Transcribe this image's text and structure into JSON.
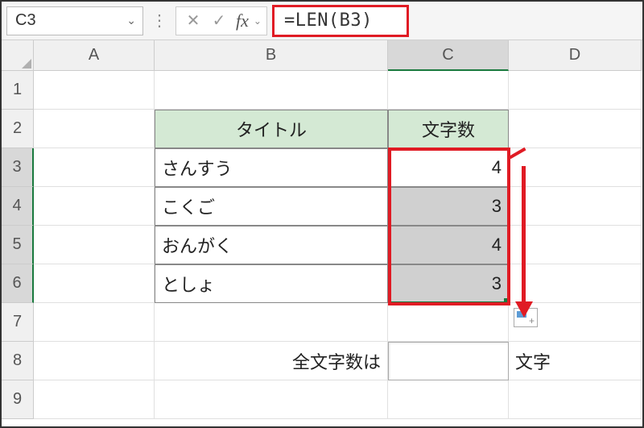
{
  "nameBox": {
    "cellRef": "C3"
  },
  "formulaBar": {
    "cancelIcon": "✕",
    "confirmIcon": "✓",
    "fxLabel": "fx",
    "formula": "=LEN(B3)"
  },
  "columns": {
    "A": "A",
    "B": "B",
    "C": "C",
    "D": "D"
  },
  "rows": {
    "r1": "1",
    "r2": "2",
    "r3": "3",
    "r4": "4",
    "r5": "5",
    "r6": "6",
    "r7": "7",
    "r8": "8",
    "r9": "9"
  },
  "table": {
    "headerTitle": "タイトル",
    "headerCount": "文字数",
    "rows": [
      {
        "title": "さんすう",
        "count": "4"
      },
      {
        "title": "こくご",
        "count": "3"
      },
      {
        "title": "おんがく",
        "count": "4"
      },
      {
        "title": "としょ",
        "count": "3"
      }
    ],
    "totalLabel": "全文字数は",
    "totalValue": "",
    "totalSuffix": "文字"
  }
}
